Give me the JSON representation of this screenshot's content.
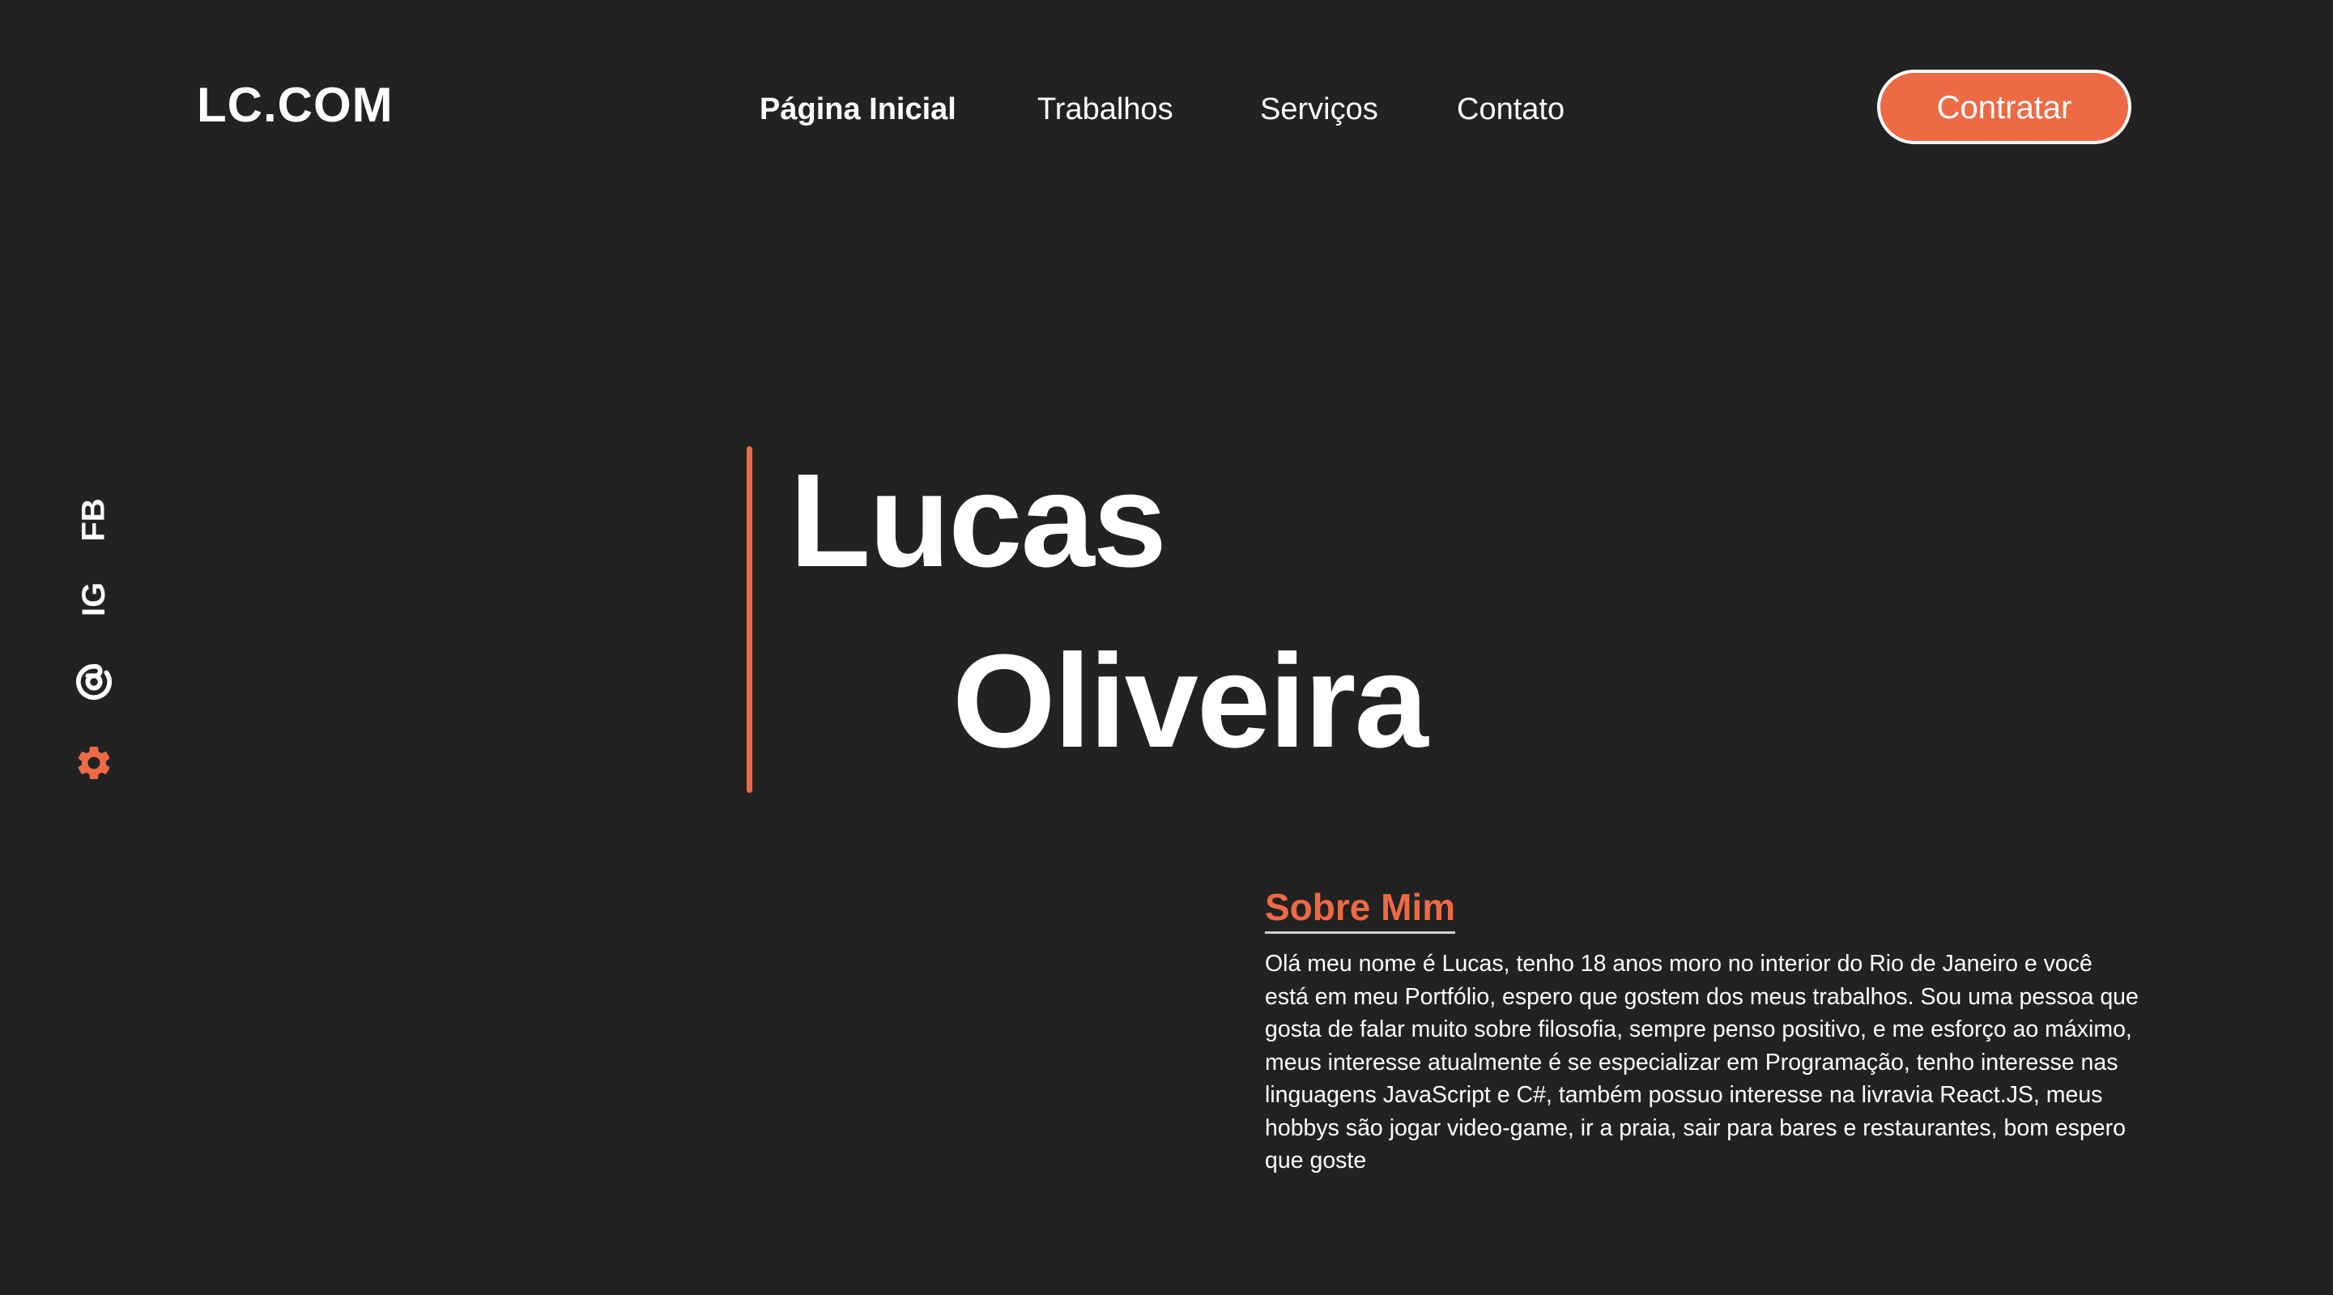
{
  "header": {
    "logo": "LC.COM",
    "nav": [
      {
        "label": "Página Inicial",
        "active": true
      },
      {
        "label": "Trabalhos",
        "active": false
      },
      {
        "label": "Serviços",
        "active": false
      },
      {
        "label": "Contato",
        "active": false
      }
    ],
    "cta_label": "Contratar"
  },
  "social": [
    {
      "label": "FB",
      "icon": "facebook-text-icon"
    },
    {
      "label": "IG",
      "icon": "instagram-text-icon"
    },
    {
      "label": "",
      "icon": "at-sign-icon"
    },
    {
      "label": "",
      "icon": "gear-icon"
    }
  ],
  "hero": {
    "first_name": "Lucas",
    "last_name": "Oliveira"
  },
  "about": {
    "title": "Sobre Mim",
    "text": "Olá meu nome é Lucas, tenho 18 anos moro no interior do Rio de Janeiro e você está em meu Portfólio, espero que gostem dos meus trabalhos. Sou uma pessoa que gosta de falar muito sobre filosofia, sempre penso positivo, e me esforço ao máximo, meus interesse atualmente é se especializar em Programação, tenho interesse nas  linguagens JavaScript e C#, também possuo interesse na livravia React.JS, meus hobbys são jogar video-game, ir a praia, sair para bares e restaurantes, bom espero que goste"
  },
  "colors": {
    "background": "#222222",
    "accent": "#ED6A45",
    "text": "#FFFFFF"
  }
}
